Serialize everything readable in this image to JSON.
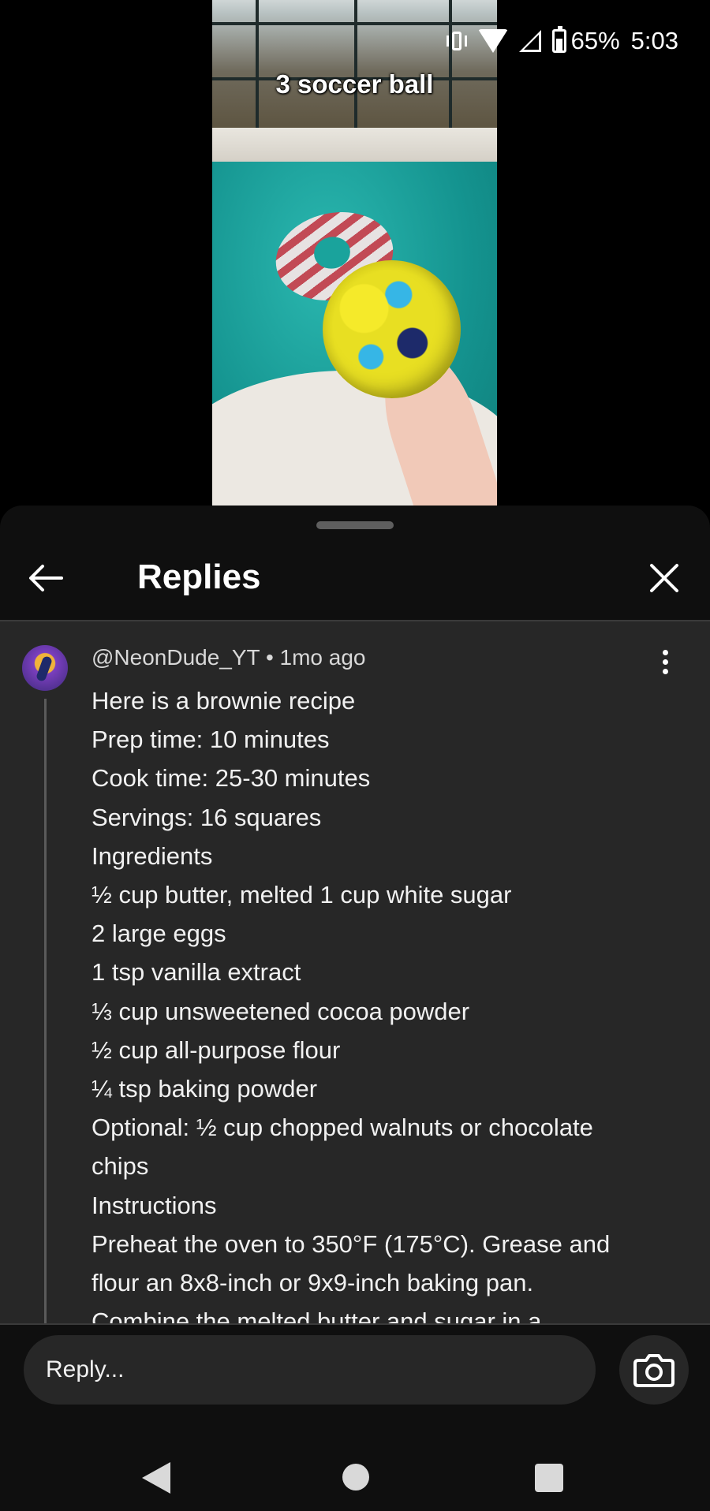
{
  "status_bar": {
    "battery_percent": "65%",
    "time": "5:03",
    "icons": [
      "vibrate-icon",
      "wifi-icon",
      "signal-icon",
      "battery-icon"
    ]
  },
  "video": {
    "caption": "3 soccer ball"
  },
  "sheet": {
    "title": "Replies",
    "back_icon": "arrow-left-icon",
    "close_icon": "close-icon"
  },
  "comment": {
    "author": "@NeonDude_YT",
    "separator": "•",
    "age": "1mo ago",
    "lines": [
      "Here is a brownie recipe",
      "Prep time: 10 minutes",
      "Cook time: 25-30 minutes",
      "Servings: 16 squares",
      "Ingredients",
      "½ cup butter, melted 1 cup white sugar",
      "2 large eggs",
      "1 tsp vanilla extract",
      "⅓ cup unsweetened cocoa powder",
      "½ cup all-purpose flour",
      "¼ tsp baking powder",
      "Optional: ½ cup chopped walnuts or chocolate",
      "chips",
      "Instructions",
      "Preheat the oven to 350°F (175°C). Grease and",
      "flour an 8x8-inch or 9x9-inch baking pan.",
      "Combine the melted butter and sugar in a"
    ]
  },
  "reply_bar": {
    "placeholder": "Reply...",
    "camera_icon": "camera-icon"
  },
  "colors": {
    "sheet_bg": "#0f0f0f",
    "content_bg": "#272727",
    "text": "#f1f1f1"
  }
}
